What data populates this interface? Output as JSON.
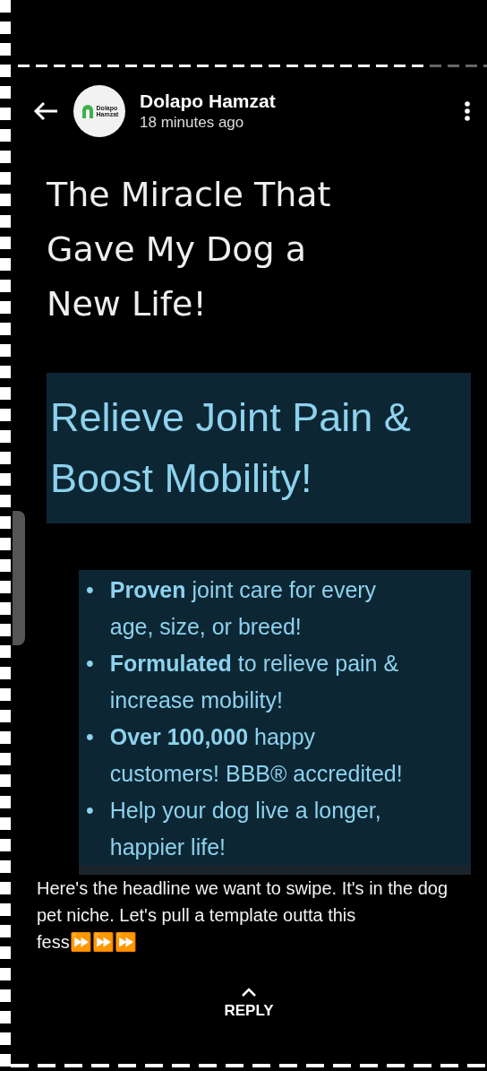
{
  "header": {
    "author": "Dolapo Hamzat",
    "time": "18 minutes ago",
    "avatar_text": [
      "Dolapo",
      "Hamzat"
    ]
  },
  "post": {
    "headline": "The Miracle That Gave My Dog a New Life!",
    "banner": "Relieve Joint Pain & Boost Mobility!",
    "bullet_marker": "•",
    "bullets": [
      "**Proven** joint care for every age, size, or breed!",
      "**Formulated** to relieve pain & increase mobility!",
      "**Over 100,000** happy customers! BBB® accredited!",
      "Help your dog live a longer, happier life!"
    ]
  },
  "progress": {
    "level": 0.87
  },
  "caption": "Here's the headline we want to swipe. It's in the dog pet niche. Let's pull a template outta this fess⏩⏩⏩",
  "reply": "REPLY"
}
